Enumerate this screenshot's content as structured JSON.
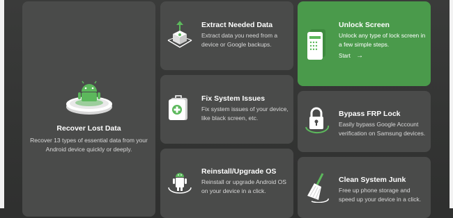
{
  "cards": {
    "recover": {
      "title": "Recover Lost Data",
      "desc": "Recover 13 types of essential data from your Android device quickly or deeply."
    },
    "extract": {
      "title": "Extract Needed Data",
      "desc": "Extract data you need from a device or Google backups."
    },
    "unlock": {
      "title": "Unlock Screen",
      "desc": "Unlock any type of lock screen in a few simple steps.",
      "start_label": "Start",
      "start_arrow": "→"
    },
    "fix": {
      "title": "Fix System Issues",
      "desc": "Fix system issues of your device, like black screen, etc."
    },
    "frp": {
      "title": "Bypass FRP Lock",
      "desc": "Easily bypass Google Account verification on Samsung devices."
    },
    "reinstall": {
      "title": "Reinstall/Upgrade OS",
      "desc": "Reinstall or upgrade Android OS on your device in a click."
    },
    "clean": {
      "title": "Clean System Junk",
      "desc": "Free up phone storage and speed up your device in a click."
    }
  },
  "icons": {
    "recover": "android-on-pedestal-icon",
    "extract": "data-box-extract-icon",
    "unlock": "phone-lock-screen-icon",
    "fix": "first-aid-kit-icon",
    "frp": "padlock-icon",
    "reinstall": "android-reinstall-icon",
    "clean": "broom-icon"
  },
  "colors": {
    "card": "#4a4b4a",
    "active_card": "#4a9a4b",
    "accent_green": "#5cb85c"
  }
}
